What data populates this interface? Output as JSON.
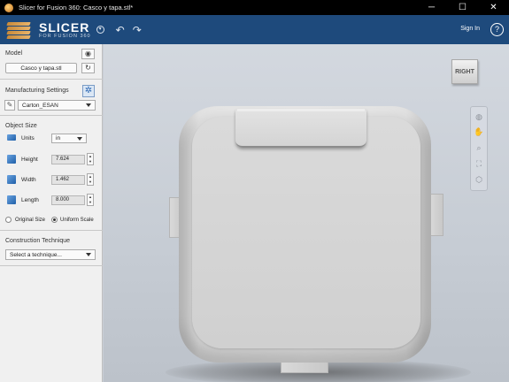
{
  "titlebar": {
    "title": "Slicer for Fusion 360: Casco y tapa.stl*",
    "minimize": "─",
    "maximize": "☐",
    "close": "✕"
  },
  "header": {
    "brand_name": "SLICER",
    "brand_sub": "FOR FUSION 360",
    "signin": "Sign In",
    "help": "?"
  },
  "panel": {
    "model": {
      "title": "Model",
      "file": "Casco y tapa.stl"
    },
    "manufacturing": {
      "title": "Manufacturing Settings",
      "selected": "Carton_ESAN"
    },
    "object_size": {
      "title": "Object Size",
      "units_label": "Units",
      "units_value": "in",
      "height_label": "Height",
      "height_value": "7.624",
      "width_label": "Width",
      "width_value": "1.462",
      "length_label": "Length",
      "length_value": "8.000",
      "original_size": "Original Size",
      "uniform_scale": "Uniform Scale"
    },
    "construction": {
      "title": "Construction Technique",
      "placeholder": "Select a technique..."
    }
  },
  "viewport": {
    "viewcube_label": "RIGHT"
  }
}
